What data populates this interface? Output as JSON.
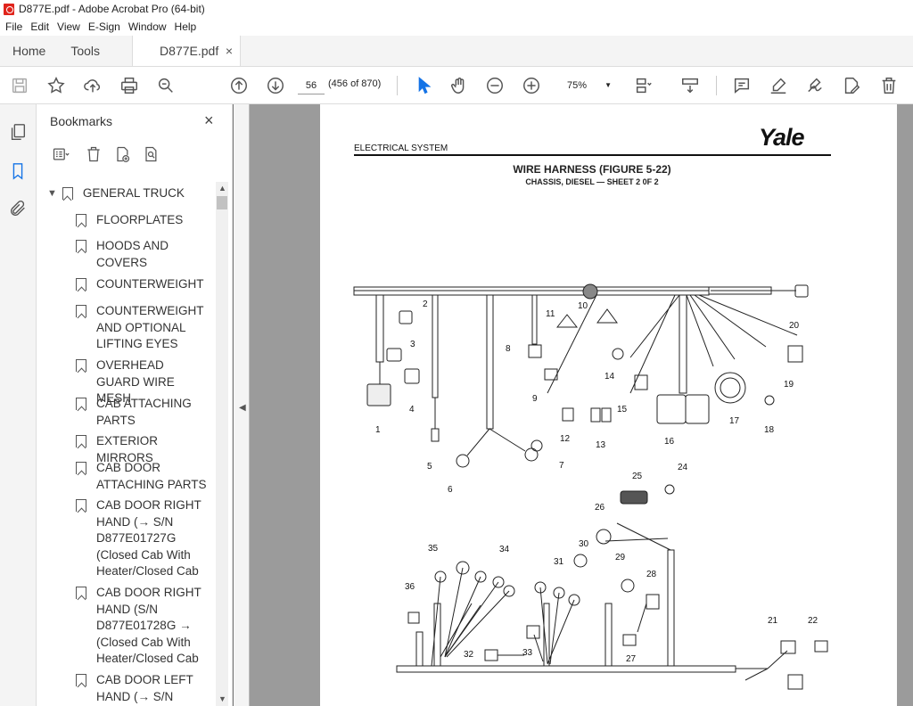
{
  "window": {
    "title": "D877E.pdf - Adobe Acrobat Pro (64-bit)"
  },
  "menu": [
    "File",
    "Edit",
    "View",
    "E-Sign",
    "Window",
    "Help"
  ],
  "tabs": {
    "home": "Home",
    "tools": "Tools",
    "document": "D877E.pdf",
    "close": "×"
  },
  "toolbar": {
    "page_number": "56",
    "page_info": "(456 of 870)",
    "zoom": "75%"
  },
  "bookmarks": {
    "title": "Bookmarks",
    "close": "×",
    "root": "GENERAL TRUCK",
    "items": [
      "FLOORPLATES",
      "HOODS AND COVERS",
      "COUNTERWEIGHT",
      "COUNTERWEIGHT AND OPTIONAL LIFTING EYES",
      "OVERHEAD GUARD WIRE MESH",
      "CAB ATTACHING PARTS",
      "EXTERIOR MIRRORS",
      "CAB DOOR ATTACHING PARTS",
      "CAB DOOR RIGHT HAND  (→ S/N D877E01727G (Closed Cab With Heater/Closed Cab",
      "CAB DOOR RIGHT HAND  (S/N D877E01728G → (Closed Cab With Heater/Closed Cab",
      "CAB DOOR LEFT HAND  (→ S/N"
    ]
  },
  "document": {
    "section": "ELECTRICAL SYSTEM",
    "logo": "Yale",
    "title": "WIRE HARNESS (FIGURE 5-22)",
    "subtitle": "CHASSIS, DIESEL — SHEET 2 0F 2",
    "callouts": [
      "1",
      "2",
      "3",
      "4",
      "5",
      "6",
      "7",
      "8",
      "9",
      "10",
      "11",
      "12",
      "13",
      "14",
      "15",
      "16",
      "17",
      "18",
      "19",
      "20",
      "21",
      "22",
      "24",
      "25",
      "26",
      "27",
      "28",
      "29",
      "30",
      "31",
      "32",
      "33",
      "34",
      "35",
      "36"
    ]
  }
}
